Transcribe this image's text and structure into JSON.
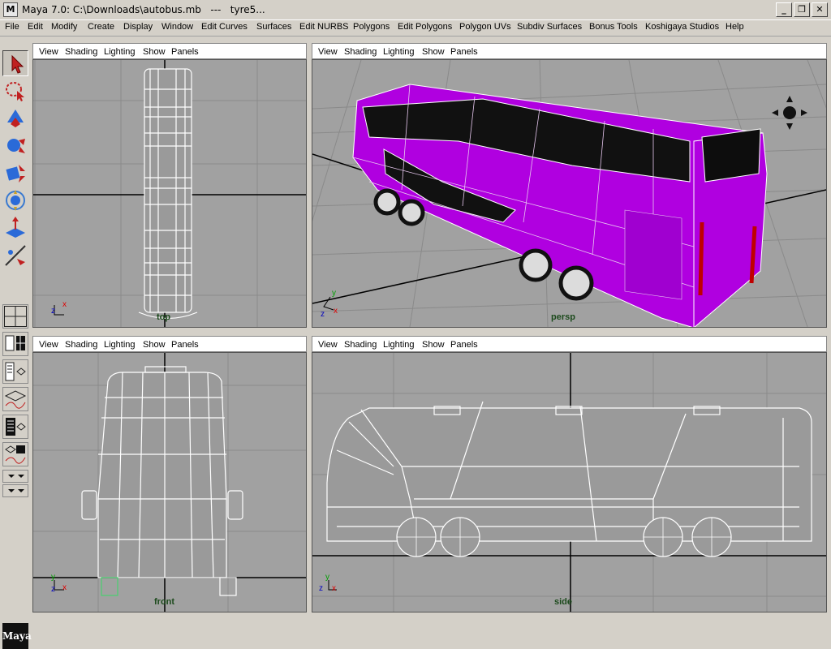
{
  "window": {
    "app_icon": "M",
    "title": "Maya 7.0: C:\\Downloads\\autobus.mb   ---   tyre5...",
    "minimize_icon": "minimize-icon",
    "maximize_icon": "restore-icon",
    "close_icon": "close-icon"
  },
  "menubar": {
    "items": [
      "File",
      "Edit",
      "Modify",
      "Create",
      "Display",
      "Window",
      "Edit Curves",
      "Surfaces",
      "Edit NURBS",
      "Polygons",
      "Edit Polygons",
      "Polygon UVs",
      "Subdiv Surfaces",
      "Bonus Tools",
      "Koshigaya Studios",
      "Help"
    ]
  },
  "toolbox": {
    "tools": [
      "select-tool-icon",
      "lasso-tool-icon",
      "paint-select-icon",
      "move-tool-icon",
      "rotate-tool-icon",
      "scale-tool-icon",
      "manipulator-icon",
      "soft-mod-icon"
    ],
    "active_tool": "select-tool-icon"
  },
  "viewport_menu": [
    "View",
    "Shading",
    "Lighting",
    "Show",
    "Panels"
  ],
  "viewports": {
    "top": {
      "label": "top"
    },
    "persp": {
      "label": "persp"
    },
    "front": {
      "label": "front"
    },
    "side": {
      "label": "side"
    }
  },
  "axis": {
    "x": "x",
    "y": "y",
    "z": "z"
  },
  "colors": {
    "bus_body": "#b000e0",
    "viewport_bg": "#a1a1a1",
    "grid_line": "#8a8a8a",
    "axis_line": "#000000",
    "wire": "#ffffff"
  },
  "logo": "Maya"
}
